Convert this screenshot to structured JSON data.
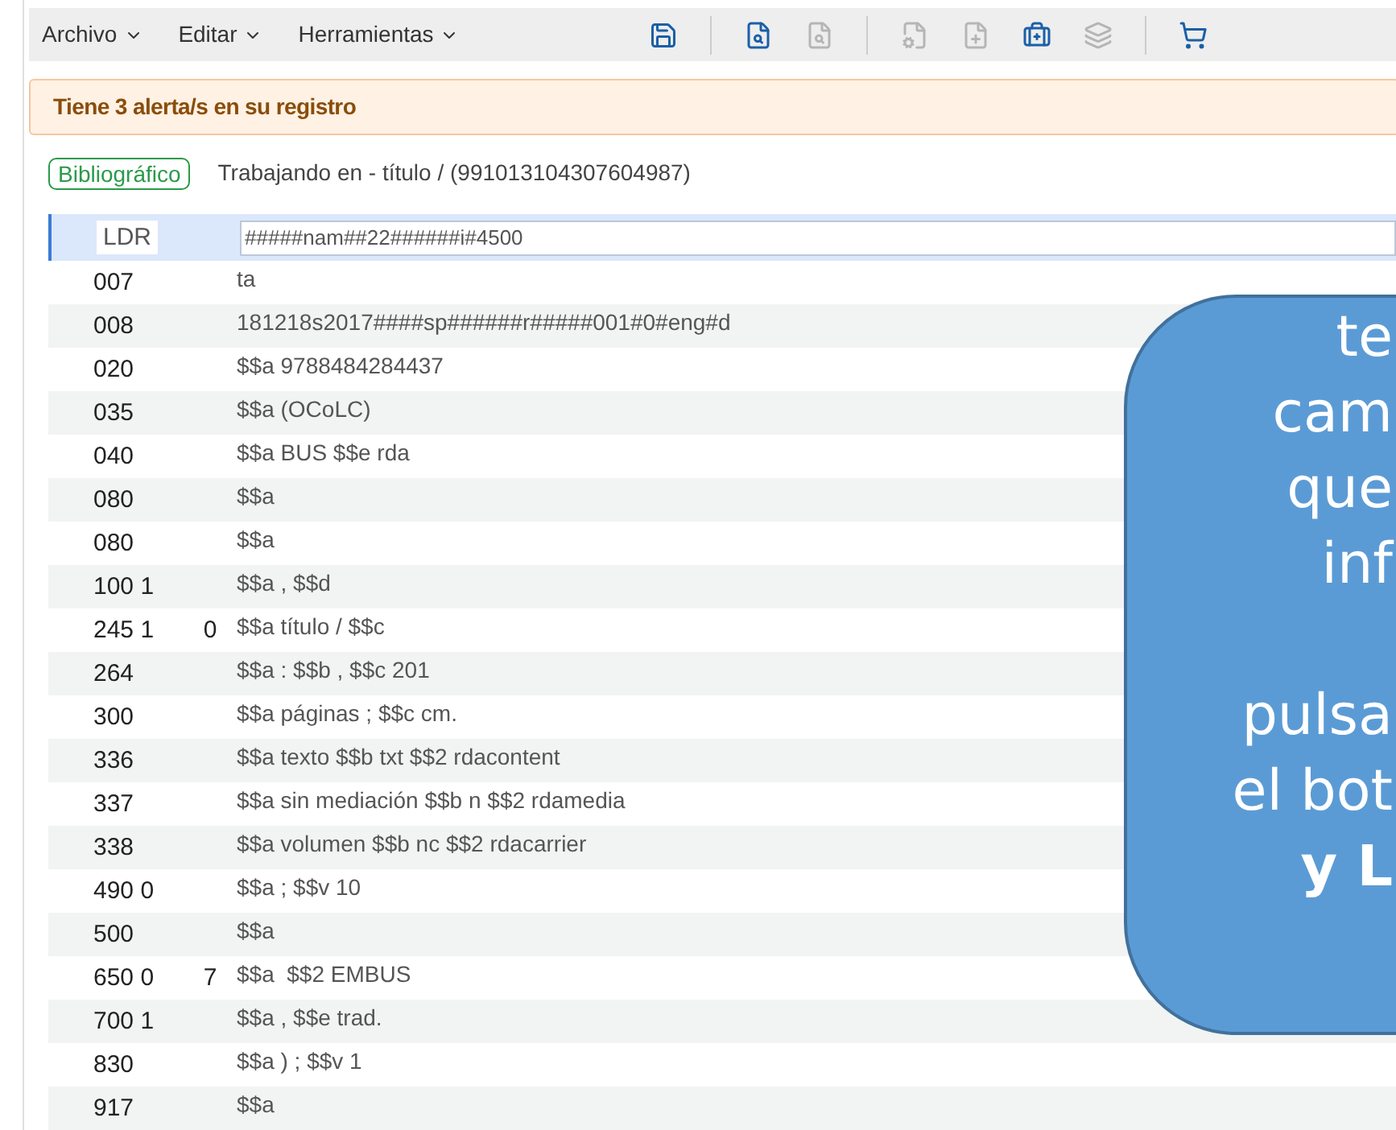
{
  "menus": [
    {
      "label": "Archivo"
    },
    {
      "label": "Editar"
    },
    {
      "label": "Herramientas"
    }
  ],
  "toolbar": [
    {
      "kind": "save",
      "disabled": false
    },
    {
      "kind": "sep"
    },
    {
      "kind": "search",
      "disabled": false
    },
    {
      "kind": "search",
      "disabled": true
    },
    {
      "kind": "sep"
    },
    {
      "kind": "gear",
      "disabled": true
    },
    {
      "kind": "plus",
      "disabled": true
    },
    {
      "kind": "case",
      "disabled": false
    },
    {
      "kind": "stack",
      "disabled": true
    },
    {
      "kind": "sep"
    },
    {
      "kind": "cart",
      "disabled": false
    }
  ],
  "alert": "Tiene 3 alerta/s en su registro",
  "badge": "Bibliográfico",
  "working": "Trabajando en - título / (991013104307604987)",
  "rows": [
    {
      "tag": "LDR",
      "ind2": "",
      "value": "#####nam##22######i#4500",
      "selected": true
    },
    {
      "tag": "007",
      "ind2": "",
      "value": "ta",
      "selected": false
    },
    {
      "tag": "008",
      "ind2": "",
      "value": "181218s2017####sp######r#####001#0#eng#d",
      "selected": false
    },
    {
      "tag": "020",
      "ind2": "",
      "value": "$$a 9788484284437",
      "selected": false
    },
    {
      "tag": "035",
      "ind2": "",
      "value": "$$a (OCoLC)",
      "selected": false
    },
    {
      "tag": "040",
      "ind2": "",
      "value": "$$a BUS $$e rda",
      "selected": false
    },
    {
      "tag": "080",
      "ind2": "",
      "value": "$$a",
      "selected": false
    },
    {
      "tag": "080",
      "ind2": "",
      "value": "$$a",
      "selected": false
    },
    {
      "tag": "100 1",
      "ind2": "",
      "value": "$$a , $$d",
      "selected": false
    },
    {
      "tag": "245 1",
      "ind2": "0",
      "value": "$$a título / $$c",
      "selected": false
    },
    {
      "tag": "264",
      "ind2": "",
      "value": "$$a : $$b , $$c 201",
      "selected": false
    },
    {
      "tag": "300",
      "ind2": "",
      "value": "$$a páginas ; $$c cm.",
      "selected": false
    },
    {
      "tag": "336",
      "ind2": "",
      "value": "$$a texto $$b txt $$2 rdacontent",
      "selected": false
    },
    {
      "tag": "337",
      "ind2": "",
      "value": "$$a sin mediación $$b n $$2 rdamedia",
      "selected": false
    },
    {
      "tag": "338",
      "ind2": "",
      "value": "$$a volumen $$b nc $$2 rdacarrier",
      "selected": false
    },
    {
      "tag": "490 0",
      "ind2": "",
      "value": "$$a ; $$v 10",
      "selected": false
    },
    {
      "tag": "500",
      "ind2": "",
      "value": "$$a",
      "selected": false
    },
    {
      "tag": "650 0",
      "ind2": "7",
      "value": "$$a  $$2 EMBUS",
      "selected": false
    },
    {
      "tag": "700 1",
      "ind2": "",
      "value": "$$a , $$e trad.",
      "selected": false
    },
    {
      "tag": "830",
      "ind2": "",
      "value": "$$a ) ; $$v 1",
      "selected": false
    },
    {
      "tag": "917",
      "ind2": "",
      "value": "$$a",
      "selected": false
    }
  ],
  "callout": {
    "lines": [
      {
        "text": "te",
        "bold": false
      },
      {
        "text": "cam",
        "bold": false
      },
      {
        "text": "que",
        "bold": false
      },
      {
        "text": "inf",
        "bold": false
      },
      {
        "text": "pulsa",
        "bold": false,
        "gap": true
      },
      {
        "text": "el bot",
        "bold": false
      },
      {
        "text": "y L",
        "bold": true
      }
    ]
  }
}
